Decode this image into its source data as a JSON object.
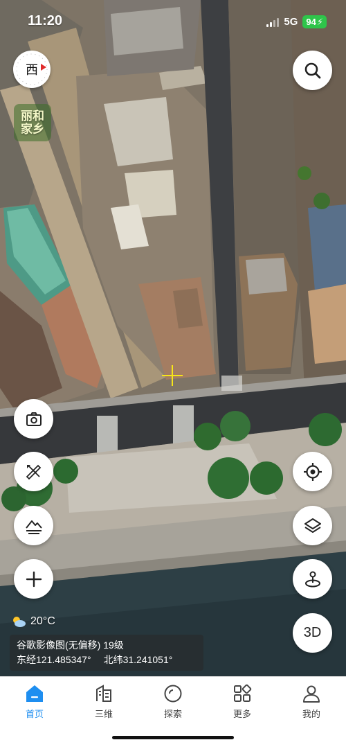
{
  "status_bar": {
    "time": "11:20",
    "network": "5G",
    "battery": "94"
  },
  "map": {
    "compass_label": "西",
    "logo_line1": "丽和",
    "logo_line2": "家乡",
    "weather": {
      "icon": "partly-cloudy-icon",
      "temperature": "20°C"
    },
    "info": {
      "layer_name": "谷歌影像图(无偏移) 19级",
      "longitude": "东经121.485347°",
      "latitude": "北纬31.241051°"
    }
  },
  "controls": {
    "search_icon": "search-icon",
    "camera_icon": "camera-icon",
    "measure_icon": "ruler-pencil-icon",
    "terrain_icon": "terrain-icon",
    "add_icon": "plus-icon",
    "locate_icon": "locate-icon",
    "layers_icon": "layers-icon",
    "pin_icon": "pin-icon",
    "mode_3d_label": "3D"
  },
  "tabs": [
    {
      "label": "首页",
      "icon": "home-icon",
      "active": true
    },
    {
      "label": "三维",
      "icon": "buildings-icon",
      "active": false
    },
    {
      "label": "探索",
      "icon": "explore-icon",
      "active": false
    },
    {
      "label": "更多",
      "icon": "apps-icon",
      "active": false
    },
    {
      "label": "我的",
      "icon": "user-icon",
      "active": false
    }
  ],
  "colors": {
    "accent": "#1e8ef0",
    "crosshair": "#f6e51a",
    "battery": "#2ec44a"
  }
}
